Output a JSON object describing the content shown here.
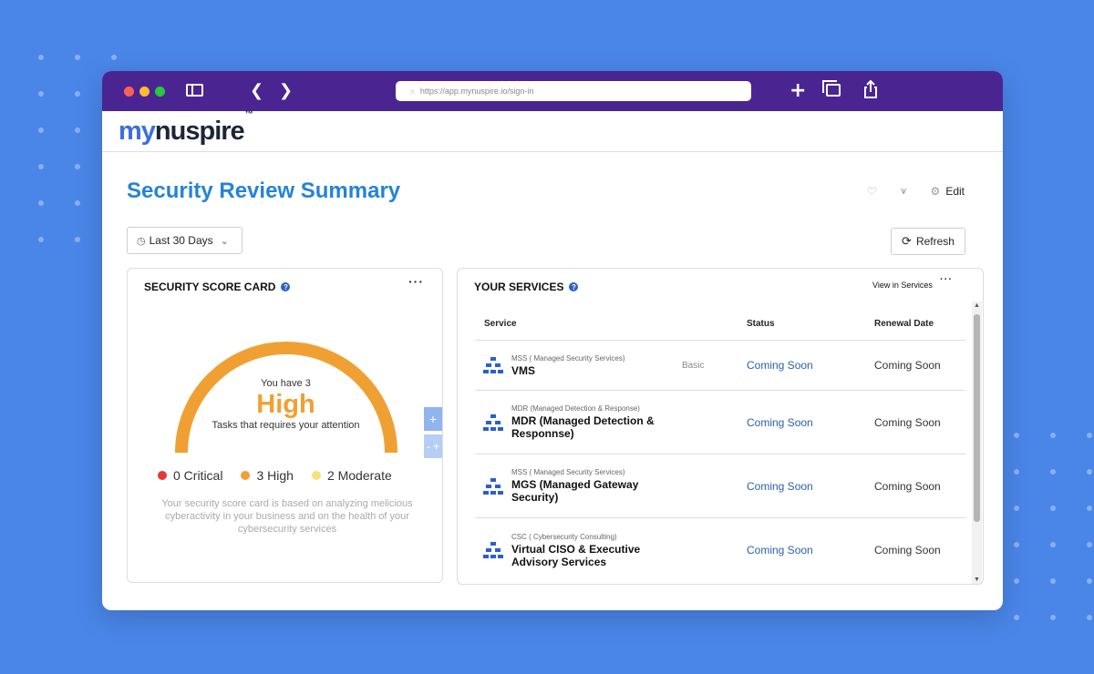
{
  "browser": {
    "url": "https://app.mynuspire.io/sign-in"
  },
  "app": {
    "logo_my": "my",
    "logo_nuspire": "nuspire",
    "logo_tm": "™"
  },
  "page": {
    "title": "Security Review Summary",
    "edit_label": "Edit",
    "date_range": "Last 30 Days",
    "refresh_label": "Refresh"
  },
  "score_card": {
    "title": "SECURITY SCORE CARD",
    "intro": "You have 3",
    "level": "High",
    "subtitle": "Tasks that requires your attention",
    "zoom_in": "+",
    "zoom_out": "- +",
    "legend": [
      {
        "label": "0 Critical",
        "color": "#e53935"
      },
      {
        "label": "3 High",
        "color": "#f0a032"
      },
      {
        "label": "2 Moderate",
        "color": "#f7e07a"
      }
    ],
    "note": "Your security score card is based on analyzing melicious cyberactivity in your business and on the health of your cybersecurity services"
  },
  "services": {
    "title": "YOUR SERVICES",
    "view_link": "View in Services",
    "columns": [
      "Service",
      "Status",
      "Renewal Date"
    ],
    "rows": [
      {
        "category": "MSS ( Managed Security Services)",
        "name": "VMS",
        "tier": "Basic",
        "status": "Coming Soon",
        "renewal": "Coming Soon"
      },
      {
        "category": "MDR (Managed Detection & Response)",
        "name": "MDR (Managed Detection & Responnse)",
        "tier": "",
        "status": "Coming Soon",
        "renewal": "Coming Soon"
      },
      {
        "category": "MSS ( Managed Security Services)",
        "name": "MGS (Managed Gateway Security)",
        "tier": "",
        "status": "Coming Soon",
        "renewal": "Coming Soon"
      },
      {
        "category": "CSC ( Cybersecurity Consulting)",
        "name": "Virtual CISO & Executive Advisory Services",
        "tier": "",
        "status": "Coming Soon",
        "renewal": "Coming Soon"
      }
    ]
  }
}
